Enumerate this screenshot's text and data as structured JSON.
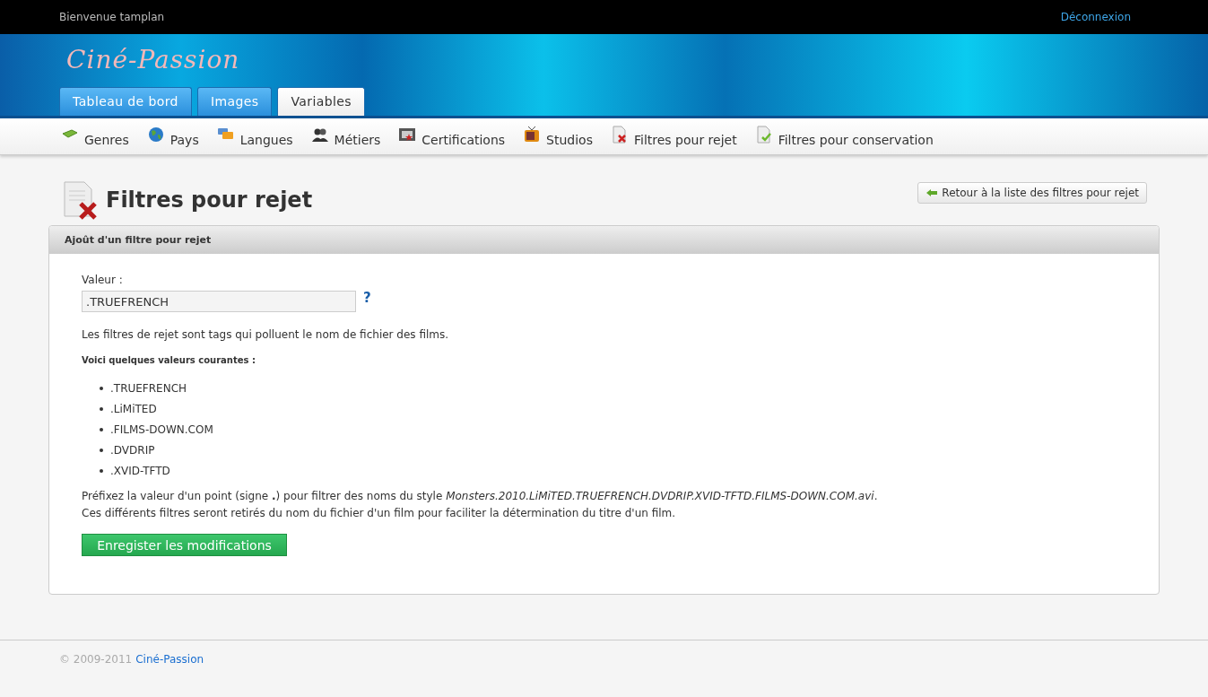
{
  "topbar": {
    "welcome": "Bienvenue tamplan",
    "logout": "Déconnexion"
  },
  "logo": "Ciné-Passion",
  "tabs": [
    {
      "label": "Tableau de bord",
      "selected": false
    },
    {
      "label": "Images",
      "selected": false
    },
    {
      "label": "Variables",
      "selected": true
    }
  ],
  "subnav": [
    {
      "label": "Genres"
    },
    {
      "label": "Pays"
    },
    {
      "label": "Langues"
    },
    {
      "label": "Métiers"
    },
    {
      "label": "Certifications"
    },
    {
      "label": "Studios"
    },
    {
      "label": "Filtres pour rejet"
    },
    {
      "label": "Filtres pour conservation"
    }
  ],
  "page_title": "Filtres pour rejet",
  "back_button": "Retour à la liste des filtres pour rejet",
  "panel": {
    "title": "Ajoût d'un filtre pour rejet",
    "field_label": "Valeur :",
    "field_value": ".TRUEFRENCH",
    "help": "?",
    "description": "Les filtres de rejet sont tags qui polluent le nom de fichier des films.",
    "list_title": "Voici quelques valeurs courantes :",
    "values": [
      ".TRUEFRENCH",
      ".LiMiTED",
      ".FILMS-DOWN.COM",
      ".DVDRIP",
      ".XVID-TFTD"
    ],
    "note_lines": [
      "Préfixez la valeur d'un point (signe **.**) pour filtrer des noms du style *Monsters.2010.LiMiTED.TRUEFRENCH.DVDRIP.XVID-TFTD.FILMS-DOWN.COM.avi*.",
      "Ces différents filtres seront retirés du nom du fichier d'un film pour faciliter la détermination du titre d'un film."
    ],
    "save_button": "Enregister les modifications"
  },
  "footer": {
    "copyright": "© 2009-2011",
    "link": "Ciné-Passion"
  }
}
